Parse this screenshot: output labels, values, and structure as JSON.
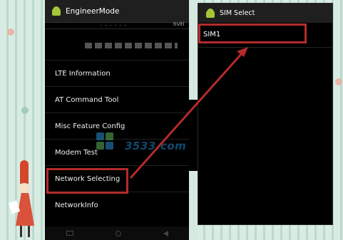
{
  "left_screen": {
    "title": "EngineerMode",
    "tab_fragment_2": "tiviti",
    "menu": [
      {
        "label": "LTE Information"
      },
      {
        "label": "AT Command Tool"
      },
      {
        "label": "Misc Feature Config"
      },
      {
        "label": "Modem Test"
      },
      {
        "label": "Network Selecting"
      },
      {
        "label": "NetworkInfo"
      }
    ]
  },
  "right_screen": {
    "title": "SIM Select",
    "items": [
      {
        "label": "SIM1"
      }
    ]
  },
  "watermark": {
    "text": "3533.com"
  },
  "colors": {
    "highlight": "#b52a2a",
    "android_green": "#a4c639",
    "screen_bg": "#000000",
    "actionbar_bg": "#1f1f1f"
  },
  "icons": {
    "app_icon": "android-icon",
    "nav_recent": "recent-apps-icon",
    "nav_home": "home-icon",
    "nav_back": "back-icon"
  }
}
